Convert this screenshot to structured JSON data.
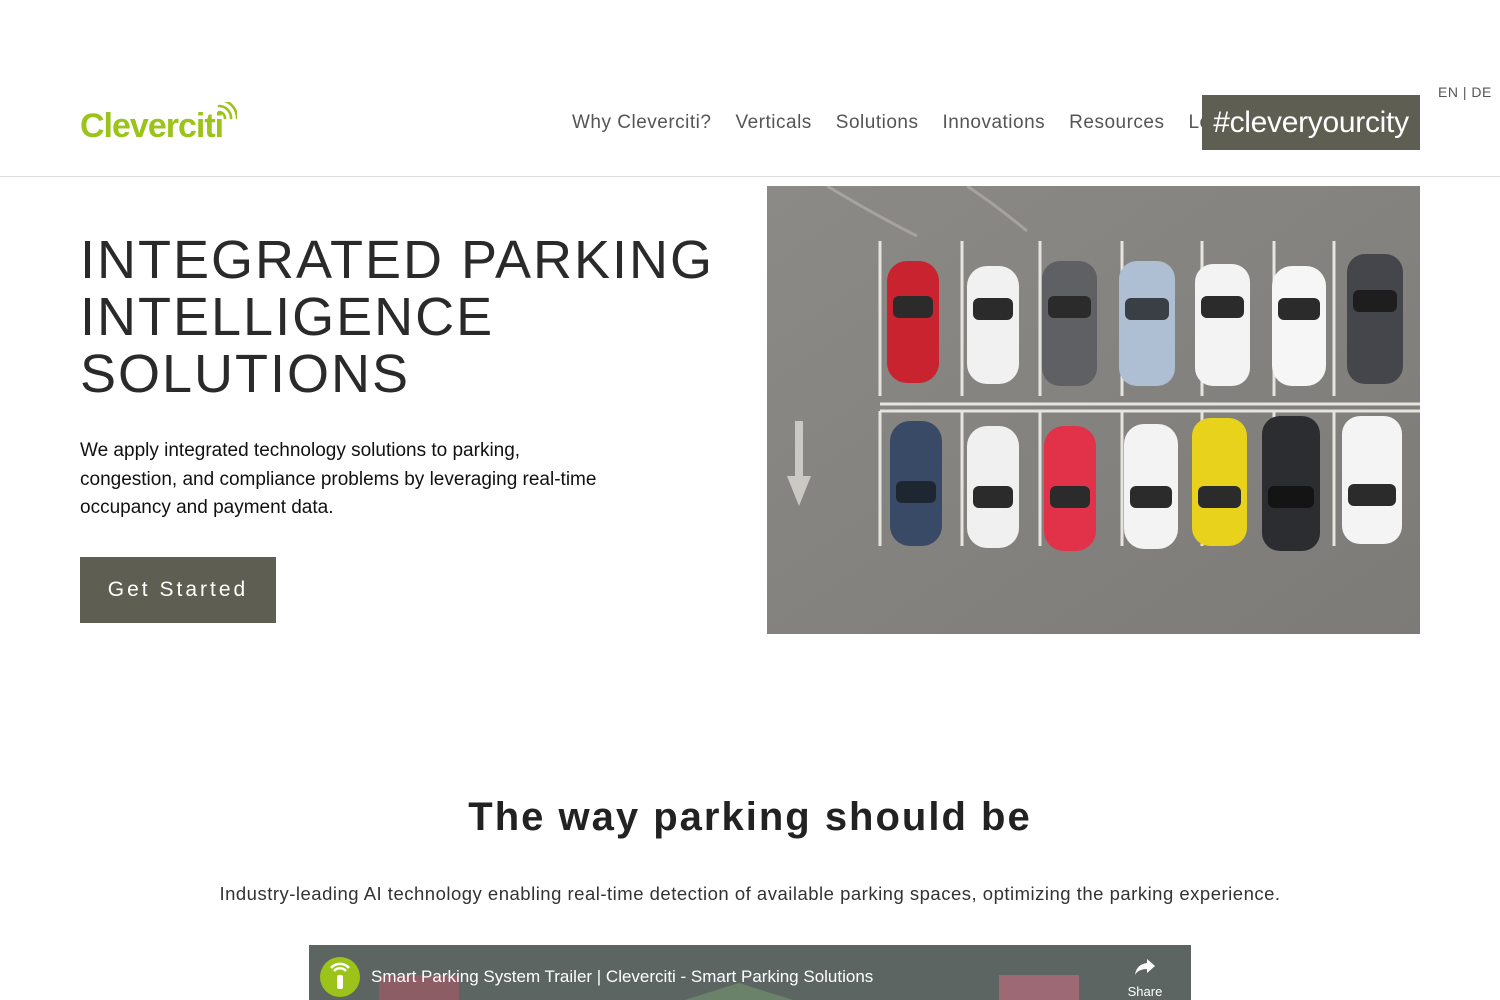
{
  "language_switch": {
    "en": "EN",
    "separator": "|",
    "de": "DE"
  },
  "brand": {
    "name": "Cleverciti",
    "color": "#9cc31a"
  },
  "nav": {
    "items": [
      {
        "label": "Why Cleverciti?"
      },
      {
        "label": "Verticals"
      },
      {
        "label": "Solutions"
      },
      {
        "label": "Innovations"
      },
      {
        "label": "Resources"
      },
      {
        "label": "Login"
      }
    ],
    "cta_label": "#cleveryourcity"
  },
  "hero": {
    "title_lines": [
      "INTEGRATED PARKING",
      "INTELLIGENCE",
      "SOLUTIONS"
    ],
    "text": "We apply integrated technology solutions to parking, congestion, and compliance problems by leveraging real-time occupancy and payment data.",
    "button_label": "Get Started"
  },
  "section": {
    "title": "The way parking should be",
    "subtitle": "Industry-leading AI technology enabling real-time detection of available parking spaces, optimizing the parking experience."
  },
  "video": {
    "title": "Smart Parking System Trailer | Cleverciti - Smart Parking Solutions",
    "share_label": "Share"
  },
  "colors": {
    "accent": "#5e5e52",
    "text": "#222222",
    "divider": "#dcdcdc"
  }
}
